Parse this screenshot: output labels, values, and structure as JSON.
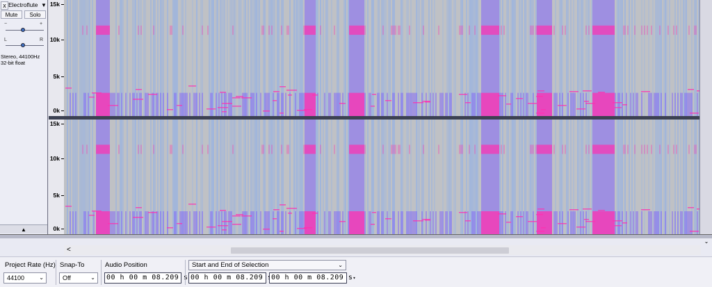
{
  "track": {
    "name": "Electroflute",
    "menu_icon": "triangle-down",
    "close_icon": "x",
    "mute_label": "Mute",
    "solo_label": "Solo",
    "gain_min": "−",
    "gain_max": "+",
    "pan_left": "L",
    "pan_right": "R",
    "info_line1": "Stereo, 44100Hz",
    "info_line2": "32-bit float",
    "collapse_icon": "▲"
  },
  "ruler": {
    "labels": [
      "15k",
      "10k",
      "5k",
      "0k"
    ]
  },
  "scroll": {
    "left_arrow": "<",
    "down_arrow": "⌄"
  },
  "selection_toolbar": {
    "project_rate_label": "Project Rate (Hz)",
    "project_rate_value": "44100",
    "snap_to_label": "Snap-To",
    "snap_to_value": "Off",
    "audio_position_label": "Audio Position",
    "audio_position_value": "00 h 00 m 08.209 s",
    "selection_mode": "Start and End of Selection",
    "selection_start": "00 h 00 m 08.209 s",
    "selection_end": "00 h 00 m 08.209 s"
  },
  "colors": {
    "spectrogram_bg": "#c3c3c3",
    "spectrogram_low": "#6fa3ff",
    "spectrogram_mid": "#7a5cff",
    "spectrogram_high": "#ff2fb0"
  }
}
